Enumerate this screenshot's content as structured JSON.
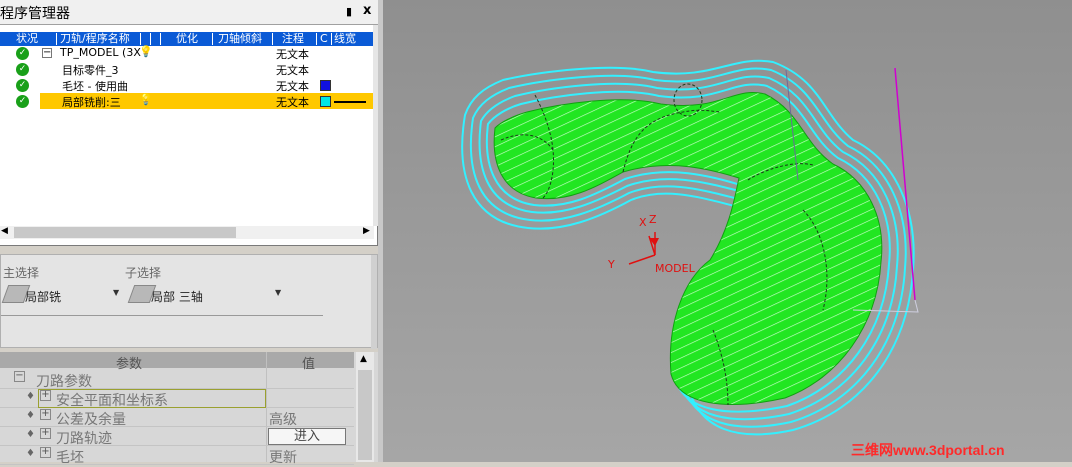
{
  "program_manager": {
    "title": "程序管理器",
    "pin_glyph": "ᅟ",
    "close_glyph": "x",
    "columns": [
      "状况",
      "刀轨/程序名称",
      "优化",
      "刀轴倾斜",
      "注程",
      "C",
      "线宽"
    ],
    "rows": [
      {
        "name": "TP_MODEL (3X",
        "comment": "无文本",
        "swatch": null,
        "bulb": true
      },
      {
        "name": "目标零件_3",
        "comment": "无文本",
        "swatch": null
      },
      {
        "name": "毛坯 - 使用曲",
        "comment": "无文本",
        "swatch": "#1010e0"
      },
      {
        "name": "局部铣削:三",
        "comment": "无文本",
        "swatch": "#00e6e6",
        "bulb": true,
        "selected": true
      }
    ]
  },
  "selection": {
    "main_label": "主选择",
    "main_value": "局部铣",
    "sub_label": "子选择",
    "sub_value": "局部 三轴"
  },
  "params": {
    "col_param": "参数",
    "col_value": "值",
    "rows": [
      {
        "label": "刀路参数",
        "value": ""
      },
      {
        "label": "安全平面和坐标系",
        "value": ""
      },
      {
        "label": "公差及余量",
        "value": "高级"
      },
      {
        "label": "刀路轨迹",
        "value": "",
        "button": "进入"
      },
      {
        "label": "毛坯",
        "value": "更新"
      }
    ]
  },
  "viewport": {
    "axis_x": "X",
    "axis_y": "Y",
    "axis_z": "Z",
    "axis_label": "MODEL",
    "watermark": "三维网www.3dportal.cn",
    "colors": {
      "surface": "#22e622",
      "toolpath": "#33f0ff",
      "axis": "#e01010",
      "tool_axis": "#d000d0"
    }
  }
}
